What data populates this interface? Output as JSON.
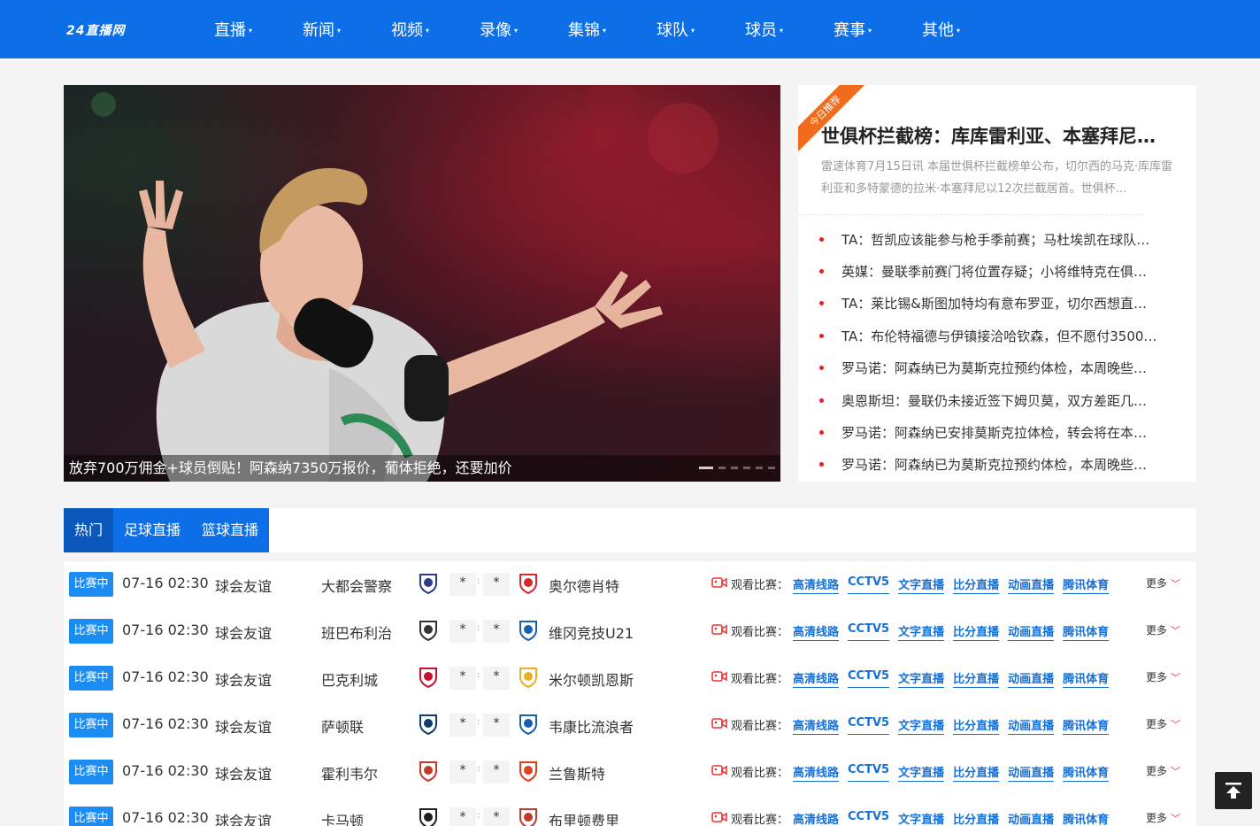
{
  "brand": {
    "logo_text": "24直播网",
    "color": "#0d6fe8"
  },
  "nav": {
    "items": [
      {
        "label": "直播"
      },
      {
        "label": "新闻"
      },
      {
        "label": "视频"
      },
      {
        "label": "录像"
      },
      {
        "label": "集锦"
      },
      {
        "label": "球队"
      },
      {
        "label": "球员"
      },
      {
        "label": "赛事"
      },
      {
        "label": "其他"
      }
    ],
    "caret": "▾"
  },
  "hero": {
    "caption": "放弃700万佣金+球员倒贴！阿森纳7350万报价，葡体拒绝，还要加价",
    "slide_count": 6,
    "active_slide": 1
  },
  "recommend": {
    "ribbon": "今日推荐",
    "title": "世俱杯拦截榜：库库雷利亚、本塞拜尼…",
    "summary": "雷速体育7月15日讯 本届世俱杯拦截榜单公布，切尔西的马克·库库雷利亚和多特蒙德的拉米·本塞拜尼以12次拦截居首。世俱杯…",
    "news": [
      "TA：哲凯应该能参与枪手季前赛；马杜埃凯在球队…",
      "英媒：曼联季前赛门将位置存疑；小将维特克在俱…",
      "TA：莱比锡&斯图加特均有意布罗亚，切尔西想直…",
      "TA：布伦特福德与伊镇接洽哈钦森，但不愿付3500…",
      "罗马诺：阿森纳已为莫斯克拉预约体检，本周晚些…",
      "奥恩斯坦：曼联仍未接近签下姆贝莫，双方差距几…",
      "罗马诺：阿森纳已安排莫斯克拉体检，转会将在本…",
      "罗马诺：阿森纳已为莫斯克拉预约体检，本周晚些…"
    ]
  },
  "tabs": [
    {
      "label": "热门",
      "active": true
    },
    {
      "label": "足球直播",
      "active": false
    },
    {
      "label": "篮球直播",
      "active": false
    }
  ],
  "match_ui": {
    "status": "比赛中",
    "watch_label": "观看比赛：",
    "links": [
      "高清线路",
      "CCTV5",
      "文字直播",
      "比分直播",
      "动画直播",
      "腾讯体育"
    ],
    "more": "更多",
    "score_placeholder": "*",
    "score_sep": ":"
  },
  "matches": [
    {
      "time": "07-16 02:30",
      "league": "球会友谊",
      "home": "大都会警察",
      "away": "奥尔德肖特",
      "home_crest": "#2a3a8c",
      "away_crest": "#d42a2a"
    },
    {
      "time": "07-16 02:30",
      "league": "球会友谊",
      "home": "班巴布利治",
      "away": "维冈竞技U21",
      "home_crest": "#333333",
      "away_crest": "#1d5fb0"
    },
    {
      "time": "07-16 02:30",
      "league": "球会友谊",
      "home": "巴克利城",
      "away": "米尔顿凯恩斯",
      "home_crest": "#c8102e",
      "away_crest": "#e8b020"
    },
    {
      "time": "07-16 02:30",
      "league": "球会友谊",
      "home": "萨顿联",
      "away": "韦康比流浪者",
      "home_crest": "#0b3d6e",
      "away_crest": "#1a5ea8"
    },
    {
      "time": "07-16 02:30",
      "league": "球会友谊",
      "home": "霍利韦尔",
      "away": "兰鲁斯特",
      "home_crest": "#c0392b",
      "away_crest": "#e23d1e"
    },
    {
      "time": "07-16 02:30",
      "league": "球会友谊",
      "home": "卡马顿",
      "away": "布里顿费里",
      "home_crest": "#1e1e1e",
      "away_crest": "#c0392b"
    }
  ],
  "back_to_top_icon": "arrow-up-to-line"
}
